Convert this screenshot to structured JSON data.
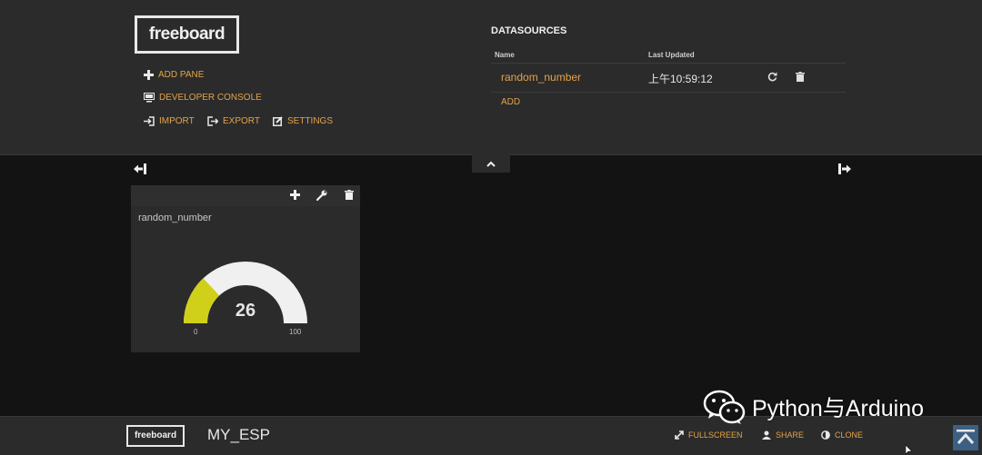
{
  "header": {
    "logo_text": "freeboard",
    "actions": {
      "add_pane": "ADD PANE",
      "developer_console": "DEVELOPER CONSOLE",
      "import": "IMPORT",
      "export": "EXPORT",
      "settings": "SETTINGS"
    }
  },
  "datasources": {
    "title": "DATASOURCES",
    "columns": {
      "name": "Name",
      "last_updated": "Last Updated"
    },
    "rows": [
      {
        "name": "random_number",
        "last_updated": "上午10:59:12"
      }
    ],
    "add_label": "ADD"
  },
  "pane": {
    "widget_title": "random_number",
    "gauge": {
      "value": 26,
      "min": 0,
      "max": 100,
      "fill_color": "#d0d01a",
      "track_color": "#f0f0f0"
    }
  },
  "footer": {
    "logo_text": "freeboard",
    "board_name": "MY_ESP",
    "fullscreen": "FULLSCREEN",
    "share": "SHARE",
    "clone": "CLONE"
  },
  "watermark": {
    "text": "Python与Arduino"
  },
  "colors": {
    "accent": "#e3a34a",
    "panel": "#2b2b2b",
    "background": "#131314"
  }
}
